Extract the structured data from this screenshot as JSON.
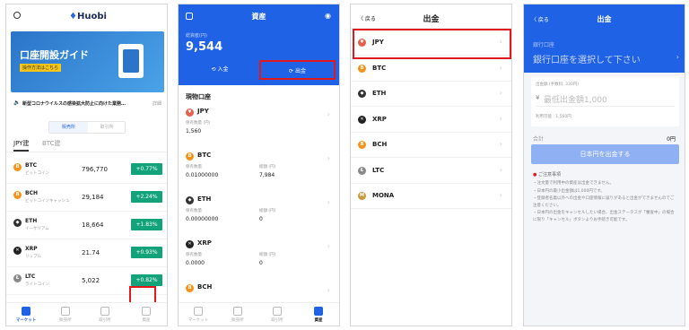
{
  "phone1": {
    "brand": "Huobi",
    "banner_title": "口座開設ガイド",
    "banner_sub": "操作方法はこちら",
    "notice": "新型コロナウイルスの感染拡大防止に向けた業務…",
    "notice_more": "詳細",
    "toggle": [
      "販売所",
      "取引所"
    ],
    "market_tabs": [
      "JPY建",
      "BTC建"
    ],
    "rows": [
      {
        "sym": "BTC",
        "name": "ビットコイン",
        "price": "796,770",
        "chg": "+0.77%",
        "color": "#f7931a",
        "icon": "B"
      },
      {
        "sym": "BCH",
        "name": "ビットコインキャッシュ",
        "price": "29,184",
        "chg": "+2.24%",
        "color": "#f7931a",
        "icon": "B"
      },
      {
        "sym": "ETH",
        "name": "イーサリアム",
        "price": "18,664",
        "chg": "+1.83%",
        "color": "#333333",
        "icon": "◆"
      },
      {
        "sym": "XRP",
        "name": "リップル",
        "price": "21.74",
        "chg": "+0.93%",
        "color": "#222222",
        "icon": "✕"
      },
      {
        "sym": "LTC",
        "name": "ライトコイン",
        "price": "5,022",
        "chg": "+0.82%",
        "color": "#8a8a8a",
        "icon": "Ł"
      }
    ],
    "tabs": [
      "マーケット",
      "販売所",
      "取引所",
      "資産"
    ]
  },
  "phone2": {
    "title": "資産",
    "total_label": "総資産(円)",
    "total": "9,544",
    "deposit": "入金",
    "withdraw": "出金",
    "section": "現物口座",
    "held_label": "保有数量",
    "jpy_sub": "保有数量 (円)",
    "value_label": "総額 (円)",
    "assets": [
      {
        "sym": "JPY",
        "qty": "1,560",
        "val": "",
        "color": "#e8604c",
        "icon": "¥"
      },
      {
        "sym": "BTC",
        "qty": "0.01000000",
        "val": "7,984",
        "color": "#f7931a",
        "icon": "B"
      },
      {
        "sym": "ETH",
        "qty": "0.00000000",
        "val": "0",
        "color": "#333333",
        "icon": "◆"
      },
      {
        "sym": "XRP",
        "qty": "0.0000",
        "val": "0",
        "color": "#222222",
        "icon": "✕"
      },
      {
        "sym": "BCH",
        "qty": "",
        "val": "",
        "color": "#f7931a",
        "icon": "B"
      }
    ],
    "tabs": [
      "マーケット",
      "販売所",
      "取引所",
      "資産"
    ]
  },
  "phone3": {
    "back": "戻る",
    "title": "出金",
    "coins": [
      {
        "sym": "JPY",
        "color": "#e8604c",
        "icon": "¥"
      },
      {
        "sym": "BTC",
        "color": "#f7931a",
        "icon": "B"
      },
      {
        "sym": "ETH",
        "color": "#333333",
        "icon": "◆"
      },
      {
        "sym": "XRP",
        "color": "#222222",
        "icon": "✕"
      },
      {
        "sym": "BCH",
        "color": "#f7931a",
        "icon": "B"
      },
      {
        "sym": "LTC",
        "color": "#8a8a8a",
        "icon": "Ł"
      },
      {
        "sym": "MONA",
        "color": "#c99a3b",
        "icon": "M"
      }
    ]
  },
  "phone4": {
    "back": "戻る",
    "title": "出金",
    "bank_label": "銀行口座",
    "bank_select": "銀行口座を選択して下さい",
    "amount_label": "出金額 (手数料: 330円)",
    "amount_placeholder": "最低出金額1,000",
    "available": "利用可能 : 1,560円",
    "total_label": "合計",
    "total_value": "0円",
    "submit": "日本円を出金する",
    "notes_title": "ご注意事項",
    "notes": [
      "・注文量で利用中の資産は出金できません。",
      "・日本円の最小出金額は1,000円です。",
      "・登録者名義以外への出金や口座情報に誤りがあると出金ができませんのでご注意ください。",
      "・日本円の出金をキャンセルしたい場合、出金ステータスが「審査中」の場合に限り「キャンセル」ボタンよりお手続き可能です。"
    ]
  },
  "colors": {
    "primary": "#1f62e6",
    "accent": "#5b8def",
    "up": "#12a37a",
    "highlight": "#e0191f"
  }
}
